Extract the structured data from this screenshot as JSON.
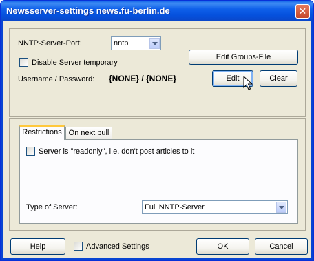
{
  "window": {
    "title": "Newsserver-settings news.fu-berlin.de"
  },
  "server": {
    "port_label": "NNTP-Server-Port:",
    "port_value": "nntp",
    "disable_label": "Disable Server temporary",
    "cred_label": "Username / Password:",
    "cred_value": "{NONE} / {NONE}",
    "edit_groups_label": "Edit Groups-File",
    "edit_label": "Edit",
    "clear_label": "Clear"
  },
  "tabs": [
    {
      "label": "Restrictions",
      "active": true
    },
    {
      "label": "On next pull",
      "active": false
    }
  ],
  "restrictions": {
    "readonly_label": "Server is \"readonly\", i.e. don't post articles to it",
    "type_label": "Type of Server:",
    "type_value": "Full NNTP-Server"
  },
  "footer": {
    "help_label": "Help",
    "advanced_label": "Advanced Settings",
    "ok_label": "OK",
    "cancel_label": "Cancel"
  },
  "icons": {
    "close": "close-icon",
    "dropdown": "chevron-down-icon",
    "cursor": "mouse-pointer-icon"
  },
  "colors": {
    "titlebar": "#0a5ee6",
    "dialog_bg": "#ece9d8",
    "button_border": "#003c74",
    "close_button": "#c4482a"
  }
}
